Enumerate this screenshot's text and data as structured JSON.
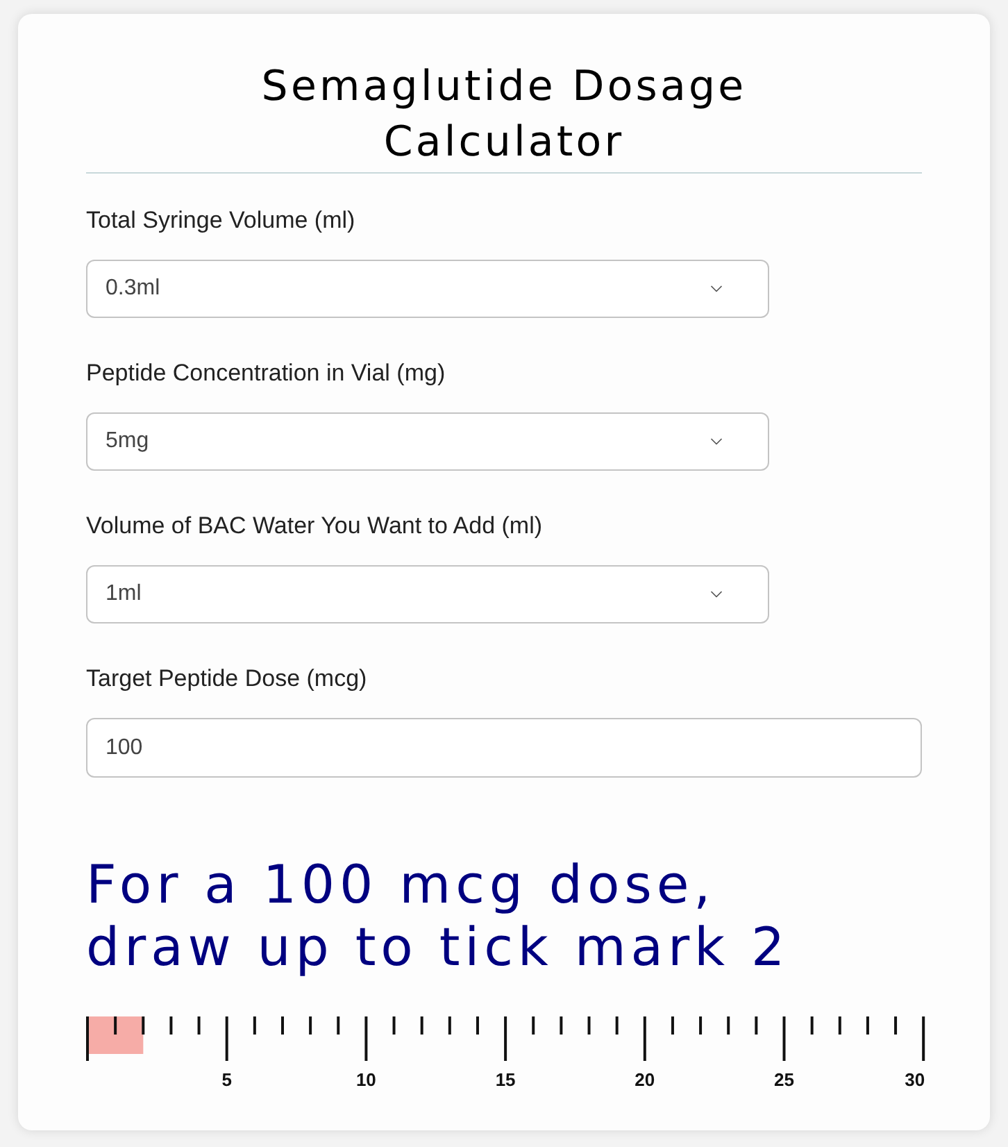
{
  "title": "Semaglutide Dosage Calculator",
  "fields": [
    {
      "kind": "select",
      "label": "Total Syringe Volume (ml)",
      "value": "0.3ml"
    },
    {
      "kind": "select",
      "label": "Peptide Concentration in Vial (mg)",
      "value": "5mg"
    },
    {
      "kind": "select",
      "label": "Volume of BAC Water You Want to Add (ml)",
      "value": "1ml"
    },
    {
      "kind": "input",
      "label": "Target Peptide Dose (mcg)",
      "value": "100"
    }
  ],
  "result": "For a 100 mcg dose, draw up to tick mark 2",
  "syringe_scale": {
    "labels": [
      "5",
      "10",
      "15",
      "20",
      "25",
      "30"
    ],
    "level": 0.0667
  }
}
